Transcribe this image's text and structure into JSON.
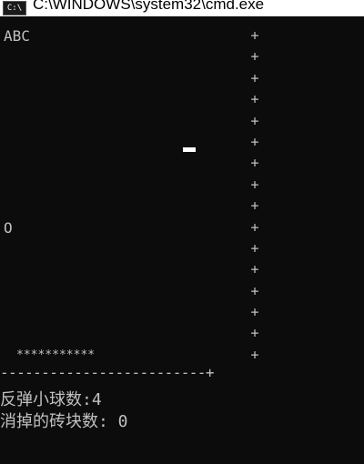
{
  "window": {
    "icon_label": "C:\\",
    "title": "C:\\WINDOWS\\system32\\cmd.exe"
  },
  "game": {
    "top_label": "ABC",
    "ball_char": "O",
    "brick_icon": "white-brick-block",
    "wall_char": "+",
    "wall_rows": 16,
    "paddle": "***********",
    "floor": "-------------------------+"
  },
  "status": {
    "bounce_line": "反弹小球数:4",
    "bricks_line": "消掉的砖块数: 0"
  },
  "colors": {
    "background": "#0c0c0c",
    "text": "#c0c0c0",
    "brick": "#ffffff"
  }
}
